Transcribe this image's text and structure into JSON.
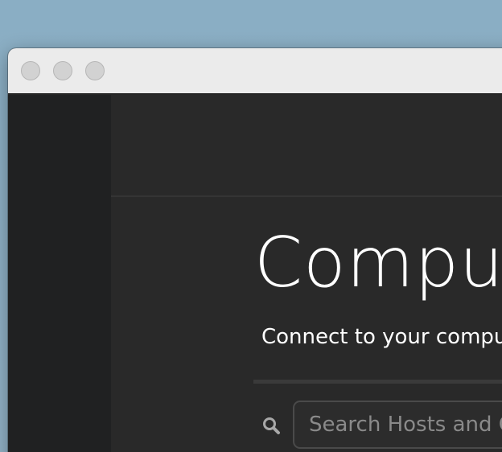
{
  "window": {
    "title": ""
  },
  "main": {
    "heading": "Compu",
    "subheading": "Connect to your compu",
    "search": {
      "placeholder": "Search Hosts and C",
      "value": ""
    }
  },
  "icons": {
    "search": "search-icon"
  },
  "colors": {
    "background": "#8aaec4",
    "titlebar": "#ebebeb",
    "sidebar": "#202122",
    "main": "#292929",
    "text": "#ffffff"
  }
}
